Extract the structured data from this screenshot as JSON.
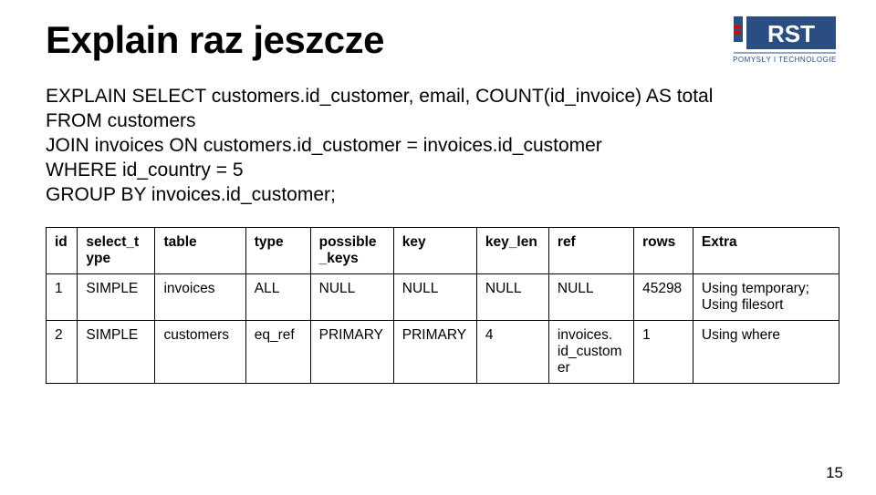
{
  "title": "Explain raz jeszcze",
  "sql": {
    "line1": "EXPLAIN SELECT customers.id_customer, email, COUNT(id_invoice) AS total",
    "line2": "FROM customers",
    "line3": "JOIN invoices ON customers.id_customer = invoices.id_customer",
    "line4": "WHERE id_country = 5",
    "line5": "GROUP BY invoices.id_customer;"
  },
  "table": {
    "headers": {
      "id": "id",
      "select_type": "select_t\nype",
      "table": "table",
      "type": "type",
      "possible_keys": "possible\n_keys",
      "key": "key",
      "key_len": "key_len",
      "ref": "ref",
      "rows": "rows",
      "extra": "Extra"
    },
    "rows": [
      {
        "id": "1",
        "select_type": "SIMPLE",
        "table": "invoices",
        "type": "ALL",
        "possible_keys": "NULL",
        "key": "NULL",
        "key_len": "NULL",
        "ref": "NULL",
        "rows": "45298",
        "extra": "Using temporary; Using filesort"
      },
      {
        "id": "2",
        "select_type": "SIMPLE",
        "table": "customers",
        "type": "eq_ref",
        "possible_keys": "PRIMARY",
        "key": "PRIMARY",
        "key_len": "4",
        "ref": "invoices.\nid_custom\ner",
        "rows": "1",
        "extra": "Using where"
      }
    ]
  },
  "page_number": "15",
  "logo": {
    "text_top": "RST",
    "text_bottom": "POMYSŁY I TECHNOLOGIE",
    "accent_color": "#2a4d82",
    "accent2_color": "#c80a14"
  }
}
